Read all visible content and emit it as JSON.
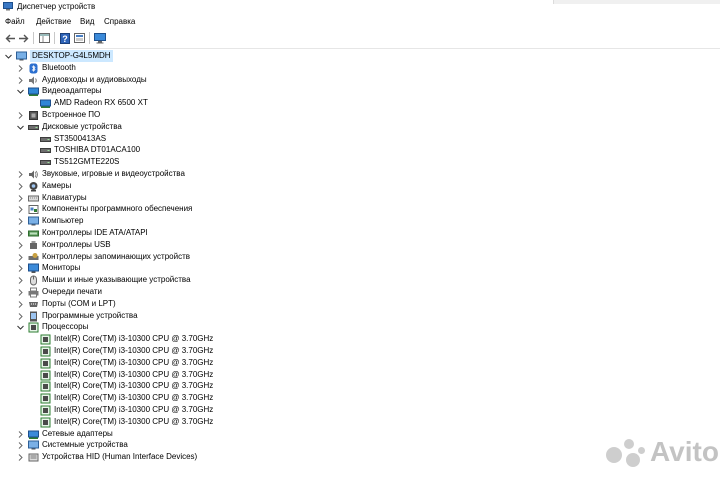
{
  "window": {
    "title": "Диспетчер устройств"
  },
  "menu": [
    "Файл",
    "Действие",
    "Вид",
    "Справка"
  ],
  "toolbar": {
    "icons": [
      "back-icon",
      "forward-icon",
      "properties-icon",
      "help-icon",
      "show-hidden-icon",
      "monitor-icon"
    ]
  },
  "tree": {
    "root": "DESKTOP-G4L5MDH",
    "rows": [
      {
        "label": "Bluetooth",
        "level": 1,
        "expanded": false,
        "icon": "bluetooth-icon"
      },
      {
        "label": "Аудиовходы и аудиовыходы",
        "level": 1,
        "expanded": false,
        "icon": "audio-io-icon"
      },
      {
        "label": "Видеоадаптеры",
        "level": 1,
        "expanded": true,
        "icon": "display-adapter-icon"
      },
      {
        "label": "AMD Radeon RX 6500 XT",
        "level": 2,
        "icon": "display-adapter-icon"
      },
      {
        "label": "Встроенное ПО",
        "level": 1,
        "expanded": false,
        "icon": "firmware-icon"
      },
      {
        "label": "Дисковые устройства",
        "level": 1,
        "expanded": true,
        "icon": "disk-drive-icon"
      },
      {
        "label": "ST3500413AS",
        "level": 2,
        "icon": "disk-drive-icon"
      },
      {
        "label": "TOSHIBA DT01ACA100",
        "level": 2,
        "icon": "disk-drive-icon"
      },
      {
        "label": "TS512GMTE220S",
        "level": 2,
        "icon": "disk-drive-icon"
      },
      {
        "label": "Звуковые, игровые и видеоустройства",
        "level": 1,
        "expanded": false,
        "icon": "speaker-icon"
      },
      {
        "label": "Камеры",
        "level": 1,
        "expanded": false,
        "icon": "camera-icon"
      },
      {
        "label": "Клавиатуры",
        "level": 1,
        "expanded": false,
        "icon": "keyboard-icon"
      },
      {
        "label": "Компоненты программного обеспечения",
        "level": 1,
        "expanded": false,
        "icon": "software-component-icon"
      },
      {
        "label": "Компьютер",
        "level": 1,
        "expanded": false,
        "icon": "computer-icon"
      },
      {
        "label": "Контроллеры IDE ATA/ATAPI",
        "level": 1,
        "expanded": false,
        "icon": "ide-controller-icon"
      },
      {
        "label": "Контроллеры USB",
        "level": 1,
        "expanded": false,
        "icon": "usb-icon"
      },
      {
        "label": "Контроллеры запоминающих устройств",
        "level": 1,
        "expanded": false,
        "icon": "storage-controller-icon"
      },
      {
        "label": "Мониторы",
        "level": 1,
        "expanded": false,
        "icon": "monitor-icon"
      },
      {
        "label": "Мыши и иные указывающие устройства",
        "level": 1,
        "expanded": false,
        "icon": "mouse-icon"
      },
      {
        "label": "Очереди печати",
        "level": 1,
        "expanded": false,
        "icon": "printer-icon"
      },
      {
        "label": "Порты (COM и LPT)",
        "level": 1,
        "expanded": false,
        "icon": "port-icon"
      },
      {
        "label": "Программные устройства",
        "level": 1,
        "expanded": false,
        "icon": "software-device-icon"
      },
      {
        "label": "Процессоры",
        "level": 1,
        "expanded": true,
        "icon": "processor-icon"
      },
      {
        "label": "Intel(R) Core(TM) i3-10300 CPU @ 3.70GHz",
        "level": 2,
        "icon": "processor-icon"
      },
      {
        "label": "Intel(R) Core(TM) i3-10300 CPU @ 3.70GHz",
        "level": 2,
        "icon": "processor-icon"
      },
      {
        "label": "Intel(R) Core(TM) i3-10300 CPU @ 3.70GHz",
        "level": 2,
        "icon": "processor-icon"
      },
      {
        "label": "Intel(R) Core(TM) i3-10300 CPU @ 3.70GHz",
        "level": 2,
        "icon": "processor-icon"
      },
      {
        "label": "Intel(R) Core(TM) i3-10300 CPU @ 3.70GHz",
        "level": 2,
        "icon": "processor-icon"
      },
      {
        "label": "Intel(R) Core(TM) i3-10300 CPU @ 3.70GHz",
        "level": 2,
        "icon": "processor-icon"
      },
      {
        "label": "Intel(R) Core(TM) i3-10300 CPU @ 3.70GHz",
        "level": 2,
        "icon": "processor-icon"
      },
      {
        "label": "Intel(R) Core(TM) i3-10300 CPU @ 3.70GHz",
        "level": 2,
        "icon": "processor-icon"
      },
      {
        "label": "Сетевые адаптеры",
        "level": 1,
        "expanded": false,
        "icon": "network-adapter-icon"
      },
      {
        "label": "Системные устройства",
        "level": 1,
        "expanded": false,
        "icon": "system-device-icon"
      },
      {
        "label": "Устройства HID (Human Interface Devices)",
        "level": 1,
        "expanded": false,
        "icon": "hid-icon"
      }
    ]
  },
  "watermark": {
    "text": "Avito"
  },
  "colors": {
    "selection": "#cce8ff",
    "cpu_green": "#2e7d32"
  }
}
